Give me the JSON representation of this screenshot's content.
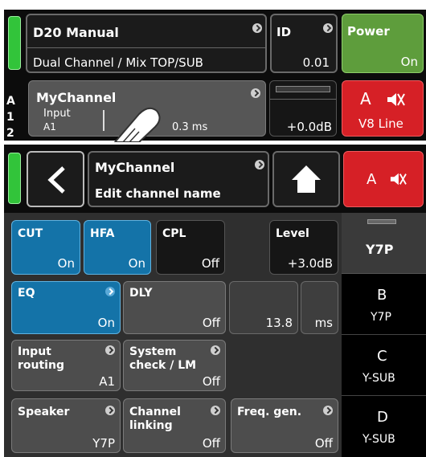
{
  "top": {
    "title": "D20 Manual",
    "mode": "Dual Channel / Mix TOP/SUB",
    "id_label": "ID",
    "id_value": "0.01",
    "power_label": "Power",
    "power_value": "On",
    "side_letters": [
      "A",
      "1",
      "2"
    ],
    "channel_name": "MyChannel",
    "input_label": "Input",
    "input_value": "A1",
    "delay": "0.3 ms",
    "gain": "+0.0dB",
    "mute_channel": "A",
    "speaker_line": "V8 Line"
  },
  "bottom": {
    "header_title": "MyChannel",
    "header_sub": "Edit channel name",
    "mute_channel": "A",
    "buttons": {
      "cut": {
        "label": "CUT",
        "value": "On"
      },
      "hfa": {
        "label": "HFA",
        "value": "On"
      },
      "cpl": {
        "label": "CPL",
        "value": "Off"
      },
      "level": {
        "label": "Level",
        "value": "+3.0dB"
      },
      "eq": {
        "label": "EQ",
        "value": "On"
      },
      "dly": {
        "label": "DLY",
        "value": "Off"
      },
      "dly_value": "13.8",
      "dly_unit": "ms",
      "input_routing": {
        "label1": "Input",
        "label2": "routing",
        "value": "A1"
      },
      "system_check": {
        "label1": "System",
        "label2": "check / LM",
        "value": "Off"
      },
      "speaker": {
        "label": "Speaker",
        "value": "Y7P"
      },
      "channel_linking": {
        "label1": "Channel",
        "label2": "linking",
        "value": "Off"
      },
      "freq_gen": {
        "label": "Freq. gen.",
        "value": "Off"
      }
    },
    "channels": [
      {
        "letter": "",
        "speaker": "Y7P"
      },
      {
        "letter": "B",
        "speaker": "Y7P"
      },
      {
        "letter": "C",
        "speaker": "Y-SUB"
      },
      {
        "letter": "D",
        "speaker": "Y-SUB"
      }
    ]
  }
}
